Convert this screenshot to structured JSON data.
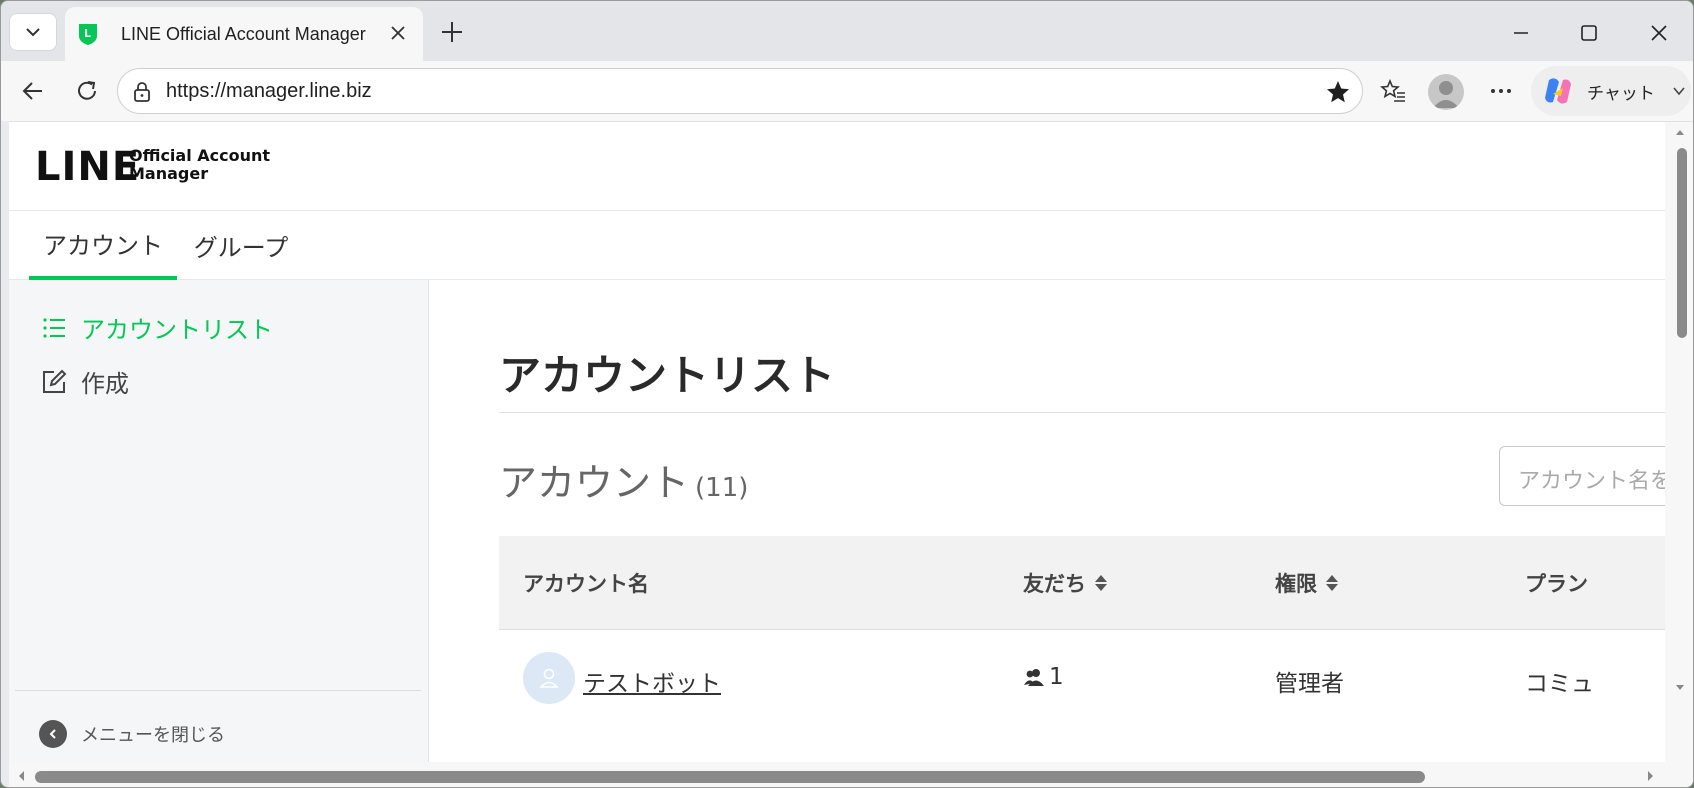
{
  "browser": {
    "tab_title": "LINE Official Account Manager",
    "url": "https://manager.line.biz",
    "copilot_label": "チャット"
  },
  "header": {
    "logo_main": "LINE",
    "logo_sub_line1": "Official Account",
    "logo_sub_line2": "Manager"
  },
  "nav": {
    "tabs": [
      {
        "label": "アカウント",
        "active": true
      },
      {
        "label": "グループ",
        "active": false
      }
    ]
  },
  "sidebar": {
    "items": [
      {
        "label": "アカウントリスト",
        "icon": "list-icon",
        "active": true
      },
      {
        "label": "作成",
        "icon": "edit-icon",
        "active": false
      }
    ],
    "close_menu": "メニューを閉じる"
  },
  "main": {
    "title": "アカウントリスト",
    "section_label": "アカウント",
    "section_count": "(11)",
    "search_placeholder": "アカウント名を",
    "table": {
      "headers": [
        "アカウント名",
        "友だち",
        "権限",
        "プラン"
      ],
      "rows": [
        {
          "name": "テストボット",
          "friends": "1",
          "role": "管理者",
          "plan": "コミュ"
        }
      ]
    }
  },
  "colors": {
    "accent": "#06c755",
    "title": "#2a2a2a"
  }
}
